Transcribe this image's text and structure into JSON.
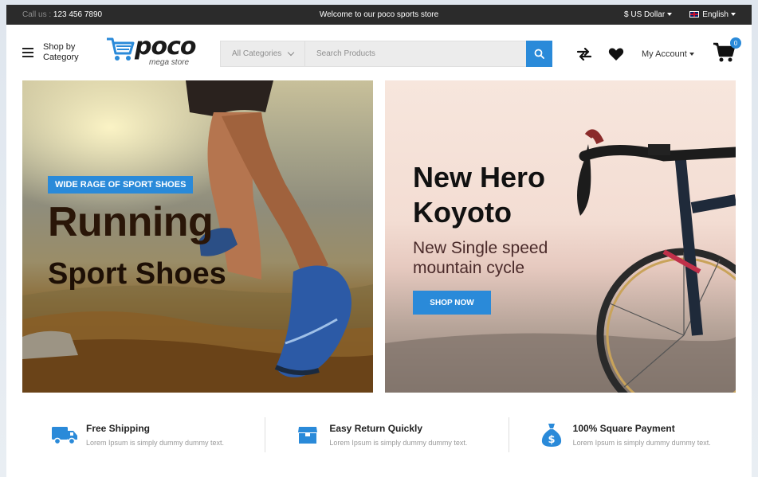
{
  "topbar": {
    "call_prefix": "Call us :",
    "phone": "123 456 7890",
    "welcome": "Welcome to our poco sports store",
    "currency": "$ US Dollar",
    "language": "English"
  },
  "header": {
    "menu_label_line1": "Shop by",
    "menu_label_line2": "Category",
    "logo_word": "poco",
    "logo_sub": "mega store",
    "category_select": "All Categories",
    "search_placeholder": "Search Products",
    "account_label": "My Account",
    "cart_count": "0"
  },
  "banners": [
    {
      "tag": "WIDE RAGE OF SPORT SHOES",
      "title": "Running",
      "subtitle": "Sport Shoes"
    },
    {
      "title": "New Hero Koyoto",
      "subtitle": "New Single speed mountain cycle",
      "button": "SHOP NOW"
    }
  ],
  "features": [
    {
      "icon": "truck-icon",
      "title": "Free Shipping",
      "desc": "Lorem Ipsum is simply dummy dummy text."
    },
    {
      "icon": "box-icon",
      "title": "Easy Return Quickly",
      "desc": "Lorem Ipsum is simply dummy dummy text."
    },
    {
      "icon": "money-bag-icon",
      "title": "100% Square Payment",
      "desc": "Lorem Ipsum is simply dummy dummy text."
    }
  ],
  "colors": {
    "accent": "#2a8ad9",
    "topbar": "#2b2b2b"
  }
}
